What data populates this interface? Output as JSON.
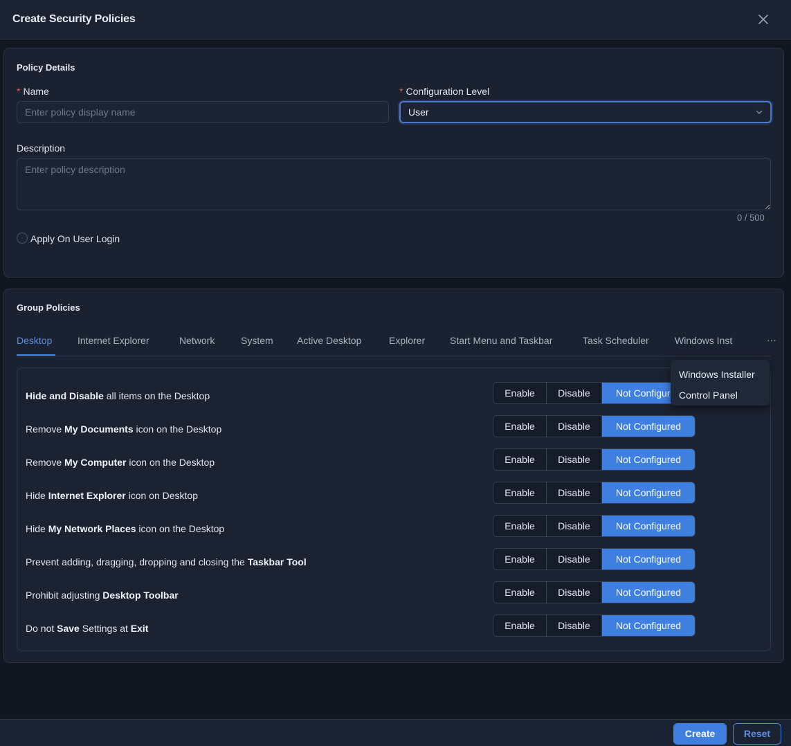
{
  "dialog": {
    "title": "Create Security Policies"
  },
  "policy_details": {
    "title": "Policy Details",
    "name_label": "Name",
    "name_placeholder": "Enter policy display name",
    "name_value": "",
    "config_label": "Configuration Level",
    "config_value": "User",
    "description_label": "Description",
    "description_placeholder": "Enter policy description",
    "description_counter": "0 / 500",
    "apply_login_label": "Apply On User Login",
    "required_mark": "*"
  },
  "group_policies": {
    "title": "Group Policies",
    "tabs": [
      {
        "label": "Desktop",
        "active": true
      },
      {
        "label": "Internet Explorer"
      },
      {
        "label": "Network"
      },
      {
        "label": "System"
      },
      {
        "label": "Active Desktop"
      },
      {
        "label": "Explorer"
      },
      {
        "label": "Start Menu and Taskbar"
      },
      {
        "label": "Task Scheduler"
      },
      {
        "label": "Windows Inst"
      }
    ],
    "more_label": "···",
    "overflow_menu": [
      "Windows Installer",
      "Control Panel"
    ],
    "options": [
      "Enable",
      "Disable",
      "Not Configured"
    ],
    "rows": [
      {
        "parts": [
          [
            "b",
            "Hide and Disable"
          ],
          [
            "t",
            " all items on the Desktop"
          ]
        ],
        "selected": "Not Configured"
      },
      {
        "parts": [
          [
            "t",
            "Remove "
          ],
          [
            "b",
            "My Documents"
          ],
          [
            "t",
            " icon on the Desktop"
          ]
        ],
        "selected": "Not Configured"
      },
      {
        "parts": [
          [
            "t",
            "Remove "
          ],
          [
            "b",
            "My Computer"
          ],
          [
            "t",
            " icon on the Desktop"
          ]
        ],
        "selected": "Not Configured"
      },
      {
        "parts": [
          [
            "t",
            "Hide "
          ],
          [
            "b",
            "Internet Explorer"
          ],
          [
            "t",
            " icon on Desktop"
          ]
        ],
        "selected": "Not Configured"
      },
      {
        "parts": [
          [
            "t",
            "Hide "
          ],
          [
            "b",
            "My Network Places"
          ],
          [
            "t",
            " icon on the Desktop"
          ]
        ],
        "selected": "Not Configured"
      },
      {
        "parts": [
          [
            "t",
            "Prevent adding, dragging, dropping and closing the "
          ],
          [
            "b",
            "Taskbar Tool"
          ]
        ],
        "selected": "Not Configured"
      },
      {
        "parts": [
          [
            "t",
            "Prohibit adjusting "
          ],
          [
            "b",
            "Desktop Toolbar"
          ]
        ],
        "selected": "Not Configured"
      },
      {
        "parts": [
          [
            "t",
            "Do not "
          ],
          [
            "b",
            "Save"
          ],
          [
            "t",
            " Settings at "
          ],
          [
            "b",
            "Exit"
          ]
        ],
        "selected": "Not Configured"
      }
    ]
  },
  "footer": {
    "create_label": "Create",
    "reset_label": "Reset"
  },
  "colors": {
    "accent": "#3f7fe0",
    "required": "#e35a5a",
    "background": "#111621",
    "panel": "#1a2130"
  }
}
